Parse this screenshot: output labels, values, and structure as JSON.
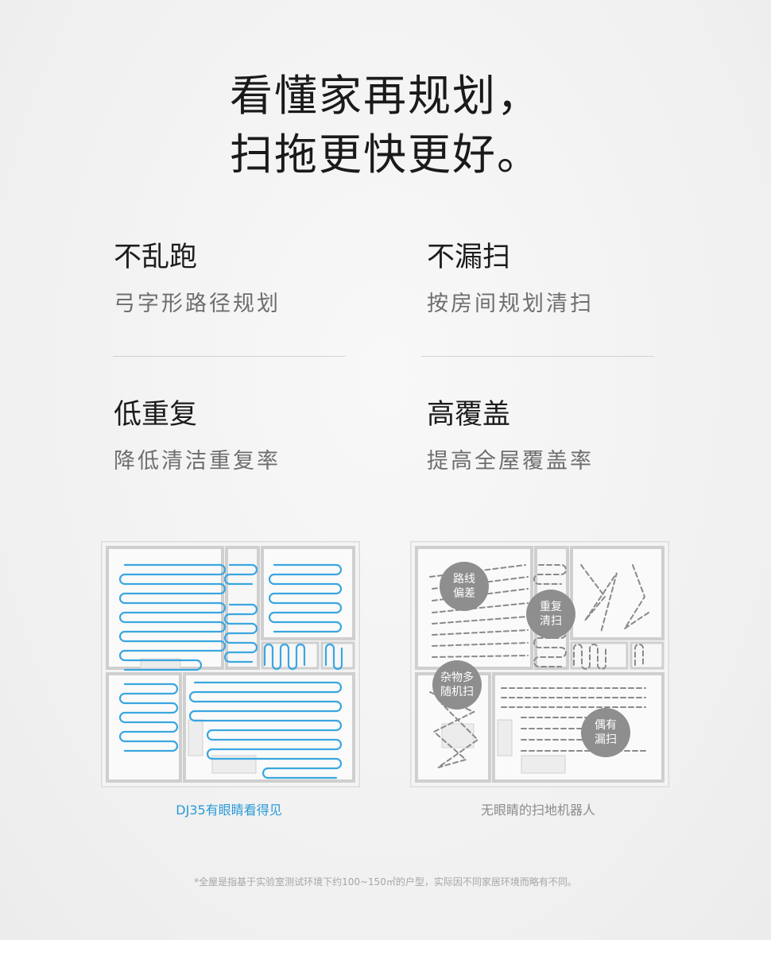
{
  "headline": {
    "line1": "看懂家再规划，",
    "line2": "扫拖更快更好。"
  },
  "features": [
    {
      "title": "不乱跑",
      "subtitle": "弓字形路径规划"
    },
    {
      "title": "不漏扫",
      "subtitle": "按房间规划清扫"
    },
    {
      "title": "低重复",
      "subtitle": "降低清洁重复率"
    },
    {
      "title": "高覆盖",
      "subtitle": "提高全屋覆盖率"
    }
  ],
  "comparison": {
    "left_caption": "DJ35有眼睛看得见",
    "right_caption": "无眼睛的扫地机器人",
    "badges": [
      {
        "line1": "路线",
        "line2": "偏差"
      },
      {
        "line1": "重复",
        "line2": "清扫"
      },
      {
        "line1": "杂物多",
        "line2": "随机扫"
      },
      {
        "line1": "偶有",
        "line2": "漏扫"
      }
    ]
  },
  "colors": {
    "path_blue": "#3aa6e0",
    "path_gray": "#8a8a8a",
    "caption_blue": "#2b9ad8",
    "badge_gray": "#8e8e8e"
  },
  "footnote": "*全屋是指基于实验室测试环境下约100~150㎡的户型，实际因不同家居环境而略有不同。"
}
